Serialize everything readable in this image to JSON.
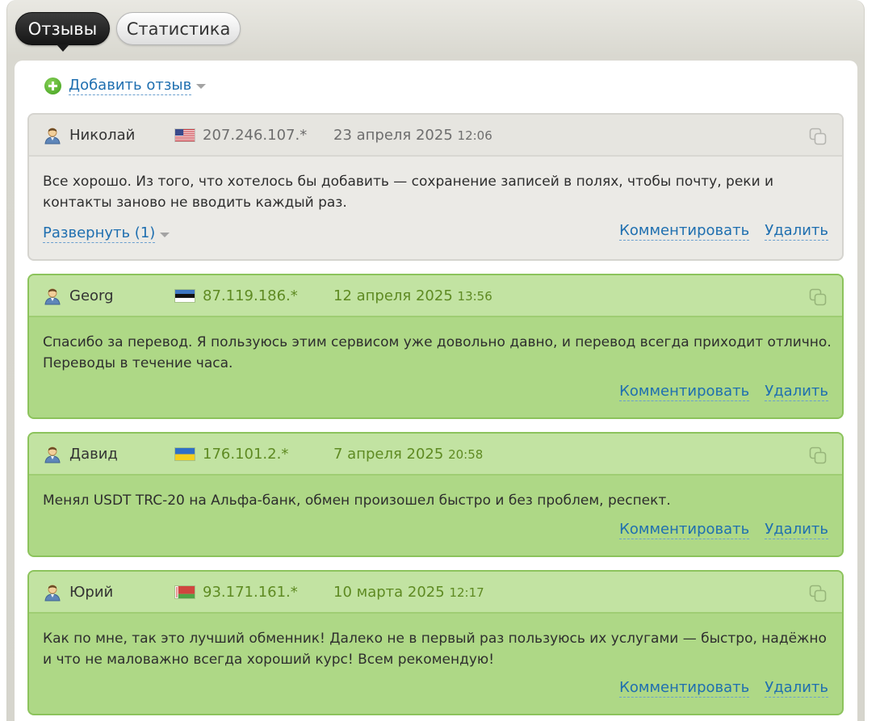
{
  "tabs": [
    {
      "label": "Отзывы",
      "active": true
    },
    {
      "label": "Статистика",
      "active": false
    }
  ],
  "add_review": {
    "label": "Добавить отзыв",
    "icon": "plus-circle-icon"
  },
  "actions": {
    "comment": "Комментировать",
    "delete": "Удалить"
  },
  "reviews": [
    {
      "user": "Николай",
      "flag": "us",
      "ip": "207.246.107.*",
      "date": "23 апреля 2025",
      "time": "12:06",
      "style": "gray",
      "text": "Все хорошо. Из того, что хотелось бы добавить — сохранение записей в полях, чтобы почту, реки и контакты заново не вводить каждый раз.",
      "expand_label": "Развернуть (1)"
    },
    {
      "user": "Georg",
      "flag": "ee",
      "ip": "87.119.186.*",
      "date": "12 апреля 2025",
      "time": "13:56",
      "style": "green",
      "text": "Спасибо за перевод. Я пользуюсь этим сервисом уже довольно давно, и перевод всегда приходит отлично. Переводы в течение часа."
    },
    {
      "user": "Давид",
      "flag": "ua",
      "ip": "176.101.2.*",
      "date": "7 апреля 2025",
      "time": "20:58",
      "style": "green",
      "text": "Менял USDT TRC-20 на Альфа-банк, обмен произошел быстро и без проблем, респект."
    },
    {
      "user": "Юрий",
      "flag": "by",
      "ip": "93.171.161.*",
      "date": "10 марта 2025",
      "time": "12:17",
      "style": "green",
      "text": "Как по мне, так это лучший обменник! Далеко не в первый раз пользуюсь их услугами — быстро, надёжно и что не маловажно всегда хороший курс! Всем рекомендую!"
    }
  ],
  "colors": {
    "link": "#1f6fb0",
    "green_card": "#aed886",
    "green_header": "#c2e3a2",
    "gray_card": "#ebeae6",
    "ip_green": "#5e8a22"
  }
}
